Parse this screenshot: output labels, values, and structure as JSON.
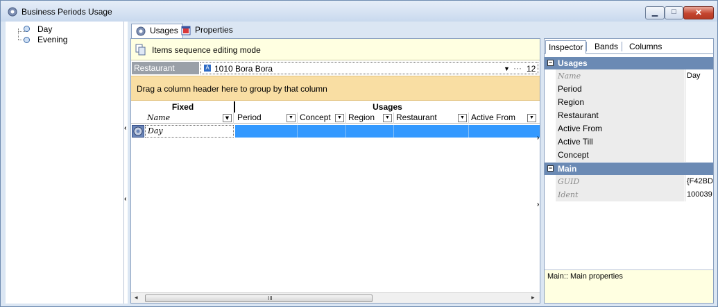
{
  "window": {
    "title": "Business Periods Usage"
  },
  "tree": {
    "items": [
      "Day",
      "Evening"
    ]
  },
  "tabs": [
    {
      "label": "Usages"
    },
    {
      "label": "Properties"
    }
  ],
  "grid": {
    "mode_text": "Items sequence editing mode",
    "filter": {
      "label": "Restaurant",
      "value": "1010 Bora Bora",
      "count": "12",
      "flag": "A"
    },
    "group_hint": "Drag a column header here to group by that column",
    "bands": {
      "fixed": "Fixed",
      "usages": "Usages"
    },
    "columns": [
      "Name",
      "Period",
      "Concept",
      "Region",
      "Restaurant",
      "Active From"
    ],
    "rows": [
      {
        "name": "Day"
      }
    ],
    "scroll_grip": "III"
  },
  "inspector": {
    "tabs": [
      "Inspector",
      "Bands",
      "Columns"
    ],
    "categories": [
      {
        "name": "Usages",
        "props": [
          {
            "name": "Name",
            "value": "Day",
            "readonly": true
          },
          {
            "name": "Period",
            "value": ""
          },
          {
            "name": "Region",
            "value": ""
          },
          {
            "name": "Restaurant",
            "value": ""
          },
          {
            "name": "Active From",
            "value": ""
          },
          {
            "name": "Active Till",
            "value": ""
          },
          {
            "name": "Concept",
            "value": ""
          }
        ]
      },
      {
        "name": "Main",
        "props": [
          {
            "name": "GUID",
            "value": "{F42BD",
            "readonly": true
          },
          {
            "name": "Ident",
            "value": "100039",
            "readonly": true
          }
        ]
      }
    ],
    "description": "Main:: Main properties"
  },
  "colors": {
    "selection": "#3399ff",
    "category": "#6b8ab4",
    "hint_panel": "#f9dea3",
    "info_bar": "#ffffe1"
  }
}
